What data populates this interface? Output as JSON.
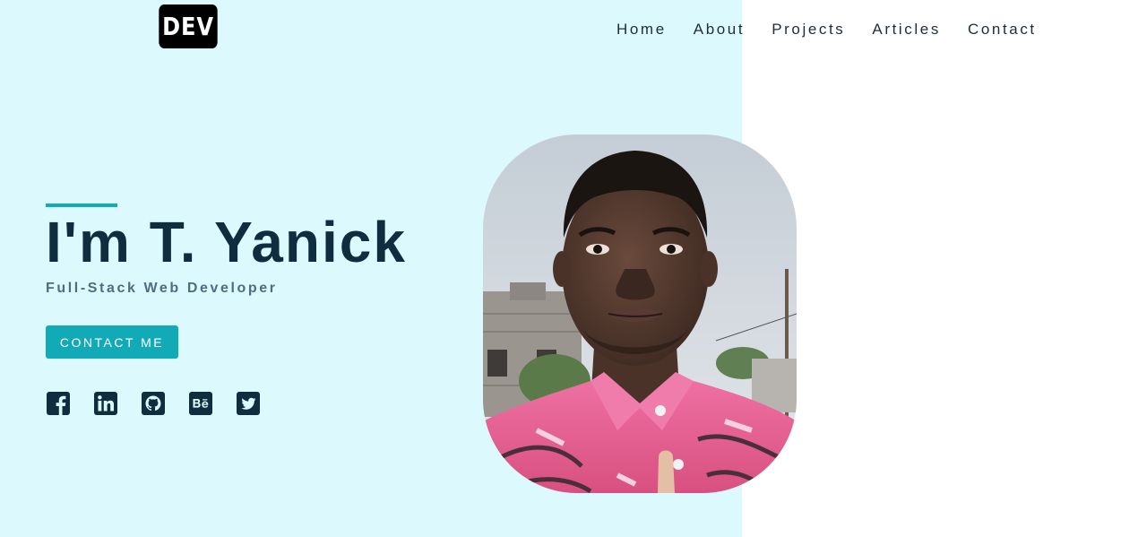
{
  "logo": {
    "text": "DEV"
  },
  "nav": {
    "items": [
      "Home",
      "About",
      "Projects",
      "Articles",
      "Contact"
    ]
  },
  "hero": {
    "title": "I'm T. Yanick",
    "subtitle": "Full-Stack Web Developer",
    "cta_label": "CONTACT ME"
  },
  "socials": [
    "facebook-icon",
    "linkedin-icon",
    "github-icon",
    "behance-icon",
    "twitter-icon"
  ],
  "colors": {
    "hero_background": "#dcfafe",
    "accent": "#12aab7",
    "heading": "#102c3f",
    "icon": "#102c3f"
  }
}
